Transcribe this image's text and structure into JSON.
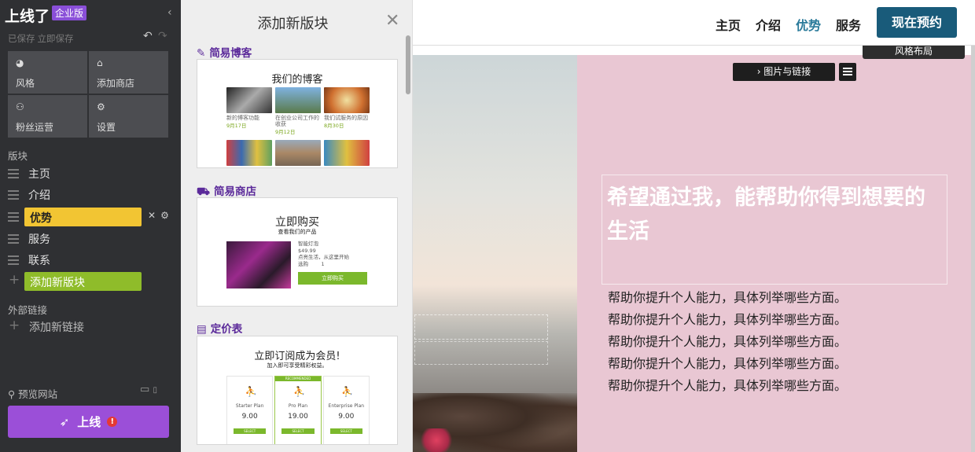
{
  "app": {
    "brand": "上线了",
    "edition": "企业版",
    "saved_text": "已保存",
    "save_now": "立即保存"
  },
  "tiles": [
    {
      "label": "风格",
      "icon": "palette-icon"
    },
    {
      "label": "添加商店",
      "icon": "store-icon"
    },
    {
      "label": "粉丝运营",
      "icon": "people-icon"
    },
    {
      "label": "设置",
      "icon": "gear-icon"
    }
  ],
  "sections_label": "版块",
  "sections": [
    {
      "label": "主页"
    },
    {
      "label": "介绍"
    },
    {
      "label": "优势",
      "active": true
    },
    {
      "label": "服务"
    },
    {
      "label": "联系"
    }
  ],
  "add_block": "添加新版块",
  "external_label": "外部链接",
  "add_link": "添加新链接",
  "preview": "预览网站",
  "golive": "上线",
  "golive_alert": "!",
  "panel": {
    "title": "添加新版块",
    "categories": [
      {
        "name": "简易博客",
        "card_title": "我们的博客",
        "posts": [
          {
            "caption": "新的博客功能",
            "date": "9月17日"
          },
          {
            "caption": "在创业公司工作的收获",
            "date": "9月12日"
          },
          {
            "caption": "我们试服务的原因",
            "date": "8月30日"
          }
        ]
      },
      {
        "name": "简易商店",
        "card_title": "立即购买",
        "card_subtitle": "查看我们的产品",
        "product": {
          "name": "智能灯泡",
          "price": "$49.99",
          "desc": "点亮生活，从这里开始",
          "select": "选购",
          "qty": "1",
          "button": "立即购买"
        }
      },
      {
        "name": "定价表",
        "card_title": "立即订阅成为会员!",
        "card_subtitle": "加入即可享受精彩权益。",
        "plans": [
          {
            "name": "Starter Plan",
            "price": "9.00",
            "button": "SELECT"
          },
          {
            "name": "Pro Plan",
            "price": "19.00",
            "button": "SELECT",
            "badge": "RECOMMENDED"
          },
          {
            "name": "Enterprise Plan",
            "price": "9.00",
            "button": "SELECT"
          }
        ]
      }
    ]
  },
  "site": {
    "nav": [
      "主页",
      "介绍",
      "优势",
      "服务"
    ],
    "active_nav": "优势",
    "cta": "现在预约",
    "style_layout": "风格布局",
    "pic_link": "› 图片与链接",
    "headline": "希望通过我，能帮助你得到想要的生活",
    "body_lines": [
      "帮助你提升个人能力，具体列举哪些方面。",
      "帮助你提升个人能力，具体列举哪些方面。",
      "帮助你提升个人能力，具体列举哪些方面。",
      "帮助你提升个人能力，具体列举哪些方面。",
      "帮助你提升个人能力，具体列举哪些方面。"
    ]
  },
  "colors": {
    "sidebar": "#2f3033",
    "accent_purple": "#9b4fd8",
    "active_yellow": "#f2c533",
    "add_green": "#8fbc2a",
    "cta_blue": "#195b7a",
    "hero_pink": "#e9c7d3"
  }
}
